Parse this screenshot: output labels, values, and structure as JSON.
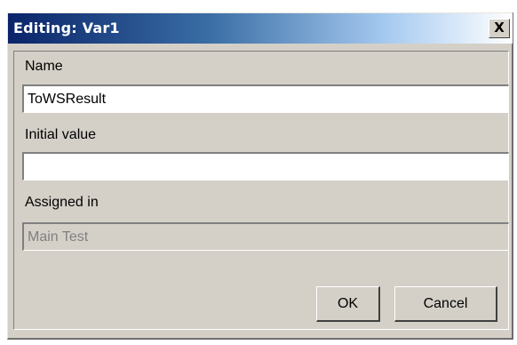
{
  "window": {
    "title": "Editing: Var1",
    "close_label": "X"
  },
  "form": {
    "name_label": "Name",
    "name_value": "ToWSResult",
    "initial_label": "Initial value",
    "initial_value": "",
    "assigned_label": "Assigned in",
    "assigned_value": "Main Test"
  },
  "buttons": {
    "ok": "OK",
    "cancel": "Cancel"
  }
}
